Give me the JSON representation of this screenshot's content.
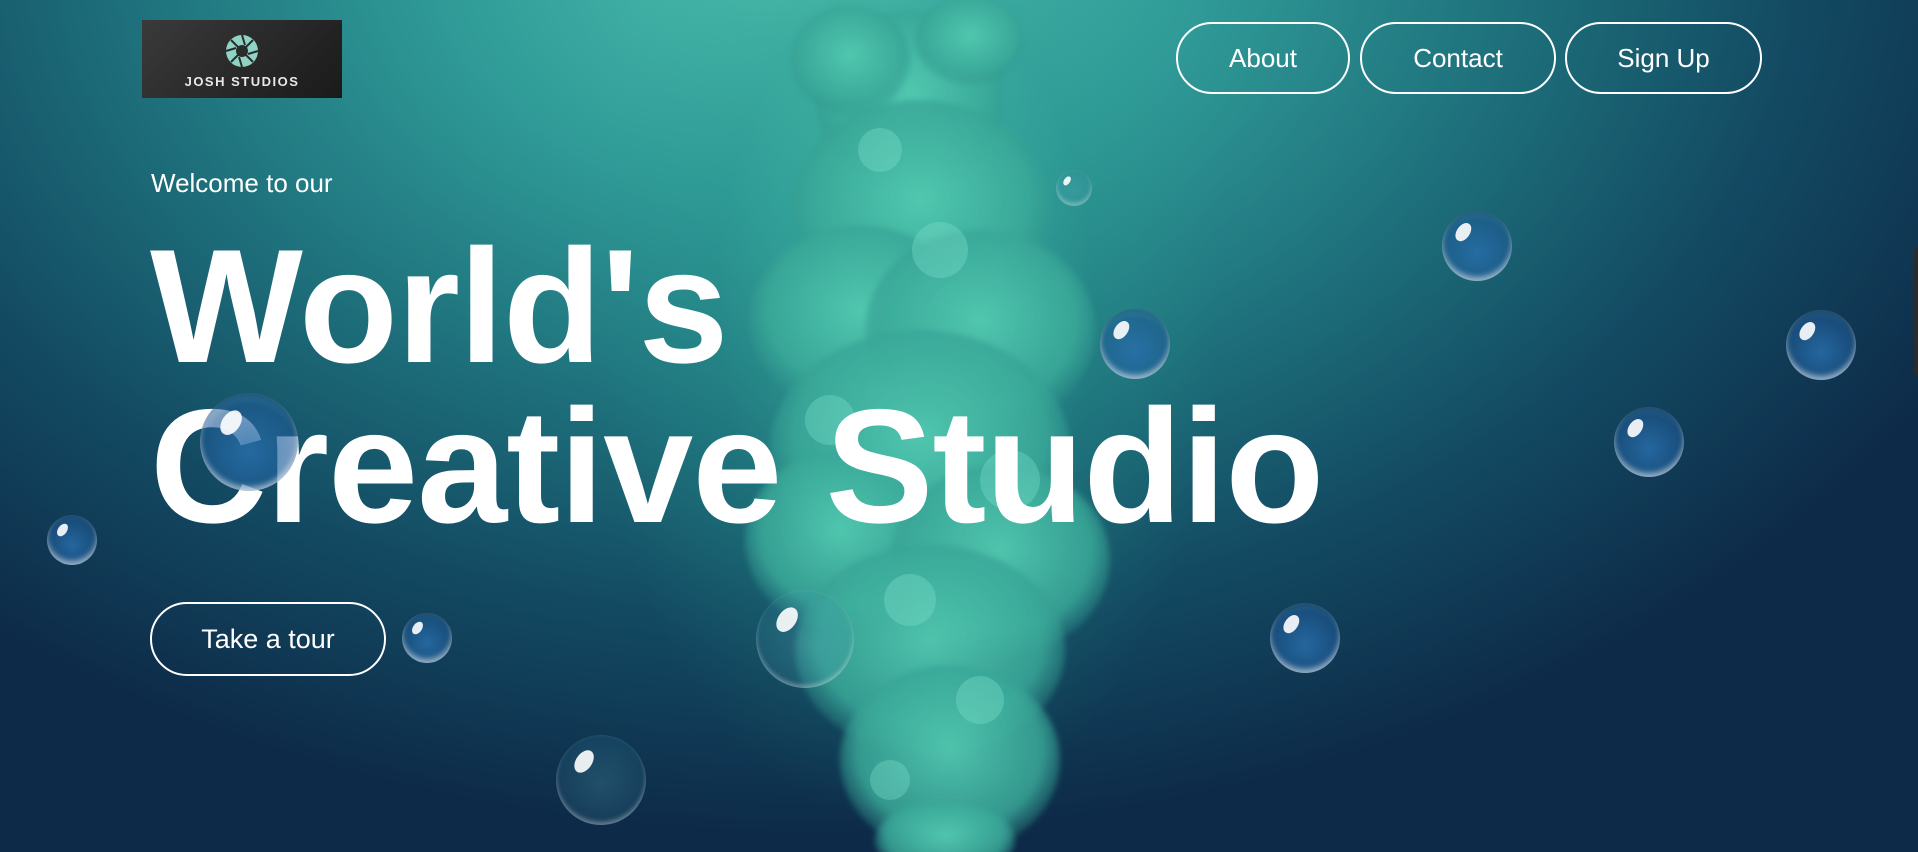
{
  "brand": {
    "logo_text": "JOSH STUDIOS"
  },
  "nav": {
    "about": "About",
    "contact": "Contact",
    "signup": "Sign Up"
  },
  "hero": {
    "welcome": "Welcome to our",
    "headline_line1": "World's",
    "headline_line2": "Creative Studio",
    "cta": "Take a tour"
  },
  "colors": {
    "accent": "#4fc3b0",
    "text": "#ffffff",
    "bubble": "#2a6ea8"
  },
  "icons": {
    "logo": "aperture-icon"
  }
}
